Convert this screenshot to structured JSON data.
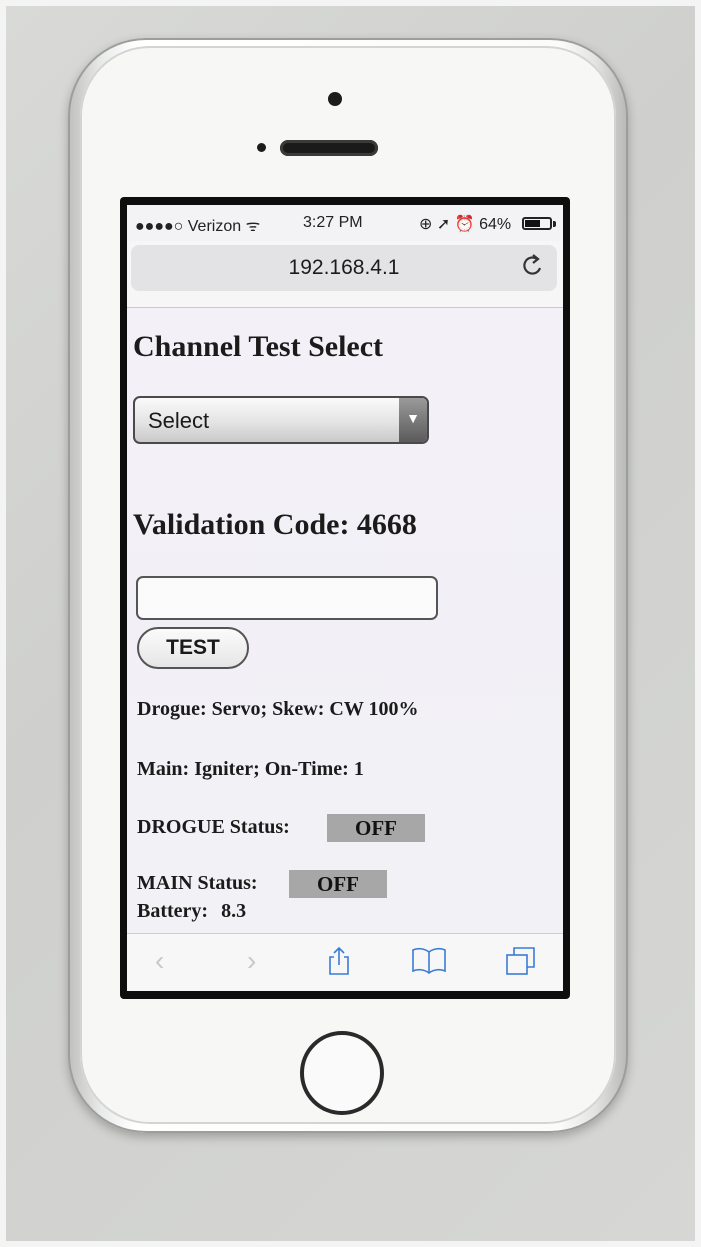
{
  "status_bar": {
    "carrier": "●●●●○ Verizon ᯤ",
    "time": "3:27 PM",
    "right": "⊕ ➚ ⏰ 64%",
    "battery_level": 0.64
  },
  "browser": {
    "url": "192.168.4.1",
    "reload_icon": "reload-icon"
  },
  "page": {
    "channel_title": "Channel Test Select",
    "select_value": "Select",
    "validation_title": "Validation Code: 4668",
    "code_input_value": "",
    "test_button": "TEST",
    "drogue_line": "Drogue: Servo; Skew: CW 100%",
    "main_line": "Main: Igniter; On-Time: 1",
    "drogue_status_label": "DROGUE Status:",
    "drogue_status_value": "OFF",
    "main_status_label": "MAIN Status:",
    "main_status_value": "OFF",
    "battery_label": "Battery:",
    "battery_value": "8.3"
  },
  "toolbar": {
    "back": "‹",
    "forward": "›",
    "colors": {
      "active": "#3b7bd6",
      "disabled": "#c8c8cc"
    }
  }
}
